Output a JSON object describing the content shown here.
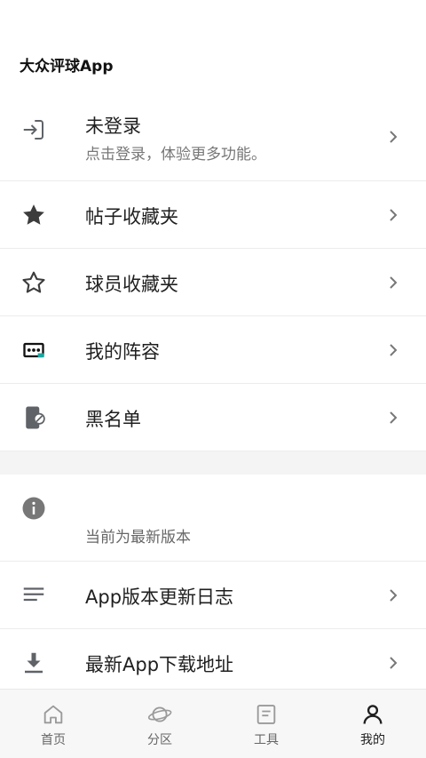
{
  "header": {
    "app_title": "大众评球App"
  },
  "list": {
    "login": {
      "title": "未登录",
      "subtitle": "点击登录，体验更多功能。",
      "icon": "login-icon"
    },
    "post_favorites": {
      "label": "帖子收藏夹",
      "icon": "star-filled-icon"
    },
    "player_favorites": {
      "label": "球员收藏夹",
      "icon": "star-outline-icon"
    },
    "my_lineup": {
      "label": "我的阵容",
      "icon": "lineup-icon"
    },
    "blacklist": {
      "label": "黑名单",
      "icon": "block-phone-icon"
    },
    "version": {
      "status": "当前为最新版本",
      "icon": "info-icon"
    },
    "changelog": {
      "label": "App版本更新日志",
      "icon": "list-lines-icon"
    },
    "download": {
      "label": "最新App下载地址",
      "icon": "download-icon"
    }
  },
  "tabbar": {
    "items": [
      {
        "label": "首页",
        "icon": "home-icon",
        "active": false
      },
      {
        "label": "分区",
        "icon": "planet-icon",
        "active": false
      },
      {
        "label": "工具",
        "icon": "notes-icon",
        "active": false
      },
      {
        "label": "我的",
        "icon": "user-icon",
        "active": true
      }
    ]
  },
  "colors": {
    "icon_gray": "#5f6368",
    "lineup_accent": "#1aa5a0",
    "separator": "#ececec",
    "section_gap": "#f4f4f4",
    "tabbar_bg": "#f7f7f7"
  }
}
